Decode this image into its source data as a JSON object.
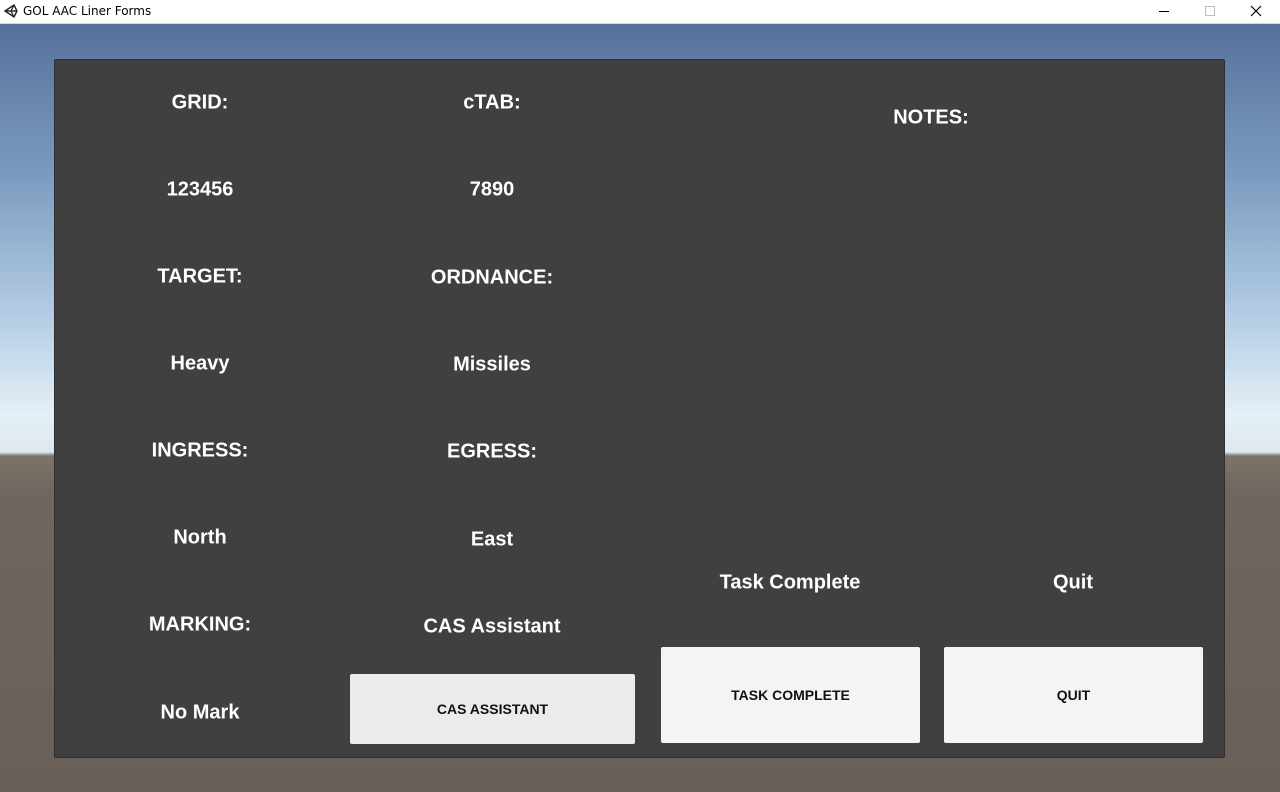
{
  "window": {
    "title": "GOL AAC Liner Forms",
    "icon": "unity-icon"
  },
  "form": {
    "grid_label": "GRID:",
    "grid_value": "123456",
    "ctab_label": "cTAB:",
    "ctab_value": "7890",
    "target_label": "TARGET:",
    "target_value": "Heavy",
    "ordnance_label": "ORDNANCE:",
    "ordnance_value": "Missiles",
    "ingress_label": "INGRESS:",
    "ingress_value": "North",
    "egress_label": "EGRESS:",
    "egress_value": "East",
    "marking_label": "MARKING:",
    "marking_value": "No Mark",
    "notes_label": "NOTES:"
  },
  "actions": {
    "cas_caption": "CAS Assistant",
    "cas_button": "CAS ASSISTANT",
    "task_caption": "Task Complete",
    "task_button": "TASK COMPLETE",
    "quit_caption": "Quit",
    "quit_button": "QUIT"
  },
  "colors": {
    "panel": "#404040",
    "label_text": "#ffffff",
    "button": "#f4f4f4",
    "sky_top": "#56719a",
    "ground": "#686058"
  }
}
